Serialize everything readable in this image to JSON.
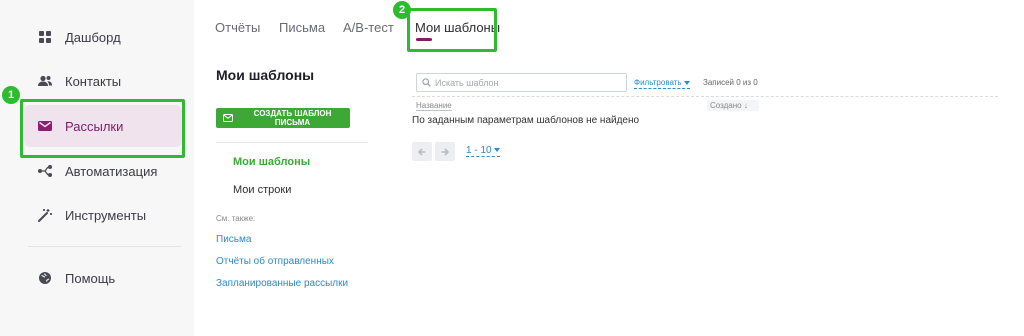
{
  "sidebar": {
    "items": [
      {
        "label": "Дашборд",
        "icon": "dashboard-icon"
      },
      {
        "label": "Контакты",
        "icon": "contacts-icon"
      },
      {
        "label": "Рассылки",
        "icon": "mail-icon",
        "active": true
      },
      {
        "label": "Автоматизация",
        "icon": "automation-icon"
      },
      {
        "label": "Инструменты",
        "icon": "magic-wand-icon"
      }
    ],
    "help_label": "Помощь"
  },
  "tabs": [
    {
      "label": "Отчёты"
    },
    {
      "label": "Письма"
    },
    {
      "label": "A/B-тест"
    },
    {
      "label": "Мои шаблоны",
      "active": true
    }
  ],
  "annotations": {
    "badge1": "1",
    "badge2": "2"
  },
  "main": {
    "title": "Мои шаблоны",
    "create_button": "СОЗДАТЬ ШАБЛОН ПИСЬМА",
    "subnav": [
      {
        "label": "Мои шаблоны",
        "active": true
      },
      {
        "label": "Мои строки"
      }
    ],
    "see_also": "См. также:",
    "links": [
      "Письма",
      "Отчёты об отправленных",
      "Запланированные рассылки"
    ]
  },
  "list": {
    "search_placeholder": "Искать шаблон",
    "filter_label": "Фильтровать",
    "records_label": "Записей 0 из 0",
    "columns": {
      "name": "Название",
      "created": "Создано ↓"
    },
    "empty_message": "По заданным параметрам шаблонов не найдено",
    "pagination_range": "1 - 10"
  },
  "colors": {
    "accent": "#7d1e66",
    "green": "#3da835",
    "highlight": "#2ebc2e",
    "link": "#2b8ad0"
  }
}
